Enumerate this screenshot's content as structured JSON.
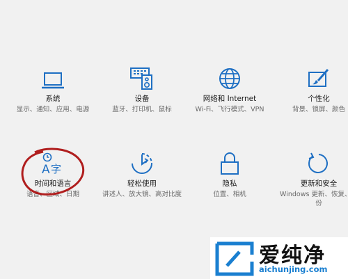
{
  "tiles": [
    {
      "name": "system",
      "icon": "laptop-icon",
      "title": "系统",
      "desc": "显示、通知、应用、电源"
    },
    {
      "name": "devices",
      "icon": "devices-icon",
      "title": "设备",
      "desc": "蓝牙、打印机、鼠标"
    },
    {
      "name": "network",
      "icon": "globe-icon",
      "title": "网络和 Internet",
      "desc": "Wi-Fi、飞行模式、VPN"
    },
    {
      "name": "personalization",
      "icon": "paint-icon",
      "title": "个性化",
      "desc": "背景、锁屏、颜色"
    },
    {
      "name": "time-language",
      "icon": "language-icon",
      "title": "时间和语言",
      "desc": "语音、区域、日期"
    },
    {
      "name": "ease-of-access",
      "icon": "ease-of-access-icon",
      "title": "轻松使用",
      "desc": "讲述人、放大镜、高对比度"
    },
    {
      "name": "privacy",
      "icon": "lock-icon",
      "title": "隐私",
      "desc": "位置、相机"
    },
    {
      "name": "update-security",
      "icon": "refresh-icon",
      "title": "更新和安全",
      "desc": "Windows 更新、恢复、备份"
    }
  ],
  "watermark": {
    "text": "爱纯净",
    "url": "aichunjing.com"
  },
  "colors": {
    "accent": "#1e6fc3",
    "circle": "#b01e1e"
  }
}
